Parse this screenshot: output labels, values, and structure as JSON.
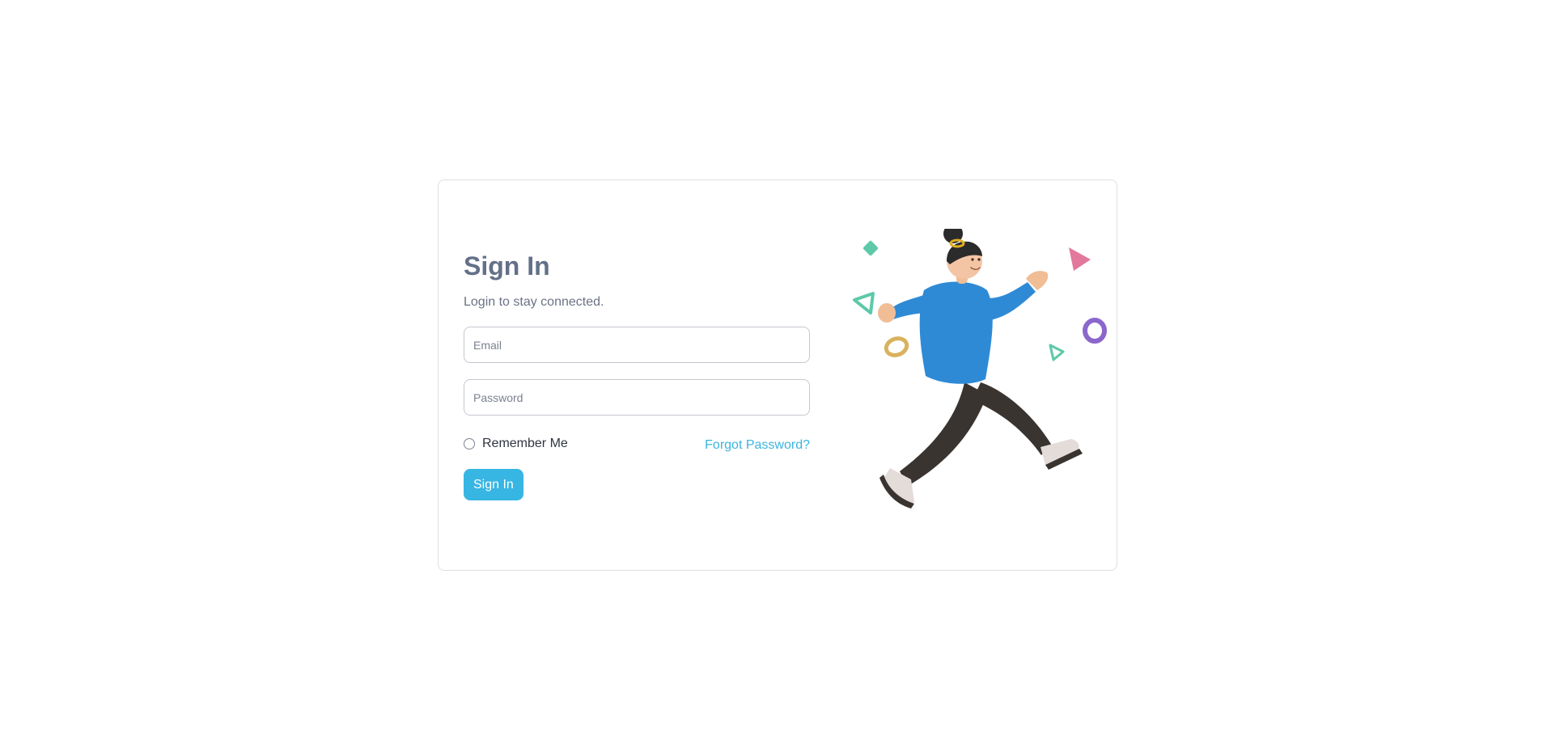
{
  "signin": {
    "title": "Sign In",
    "subtitle": "Login to stay connected.",
    "email_placeholder": "Email",
    "password_placeholder": "Password",
    "remember_label": "Remember Me",
    "remember_checked": false,
    "forgot_label": "Forgot Password?",
    "submit_label": "Sign In"
  },
  "colors": {
    "title": "#637089",
    "accent": "#38b6e3",
    "link": "#3ab4df",
    "border": "#dcdfe4"
  },
  "illustration": {
    "icon": "running-person-illustration"
  }
}
